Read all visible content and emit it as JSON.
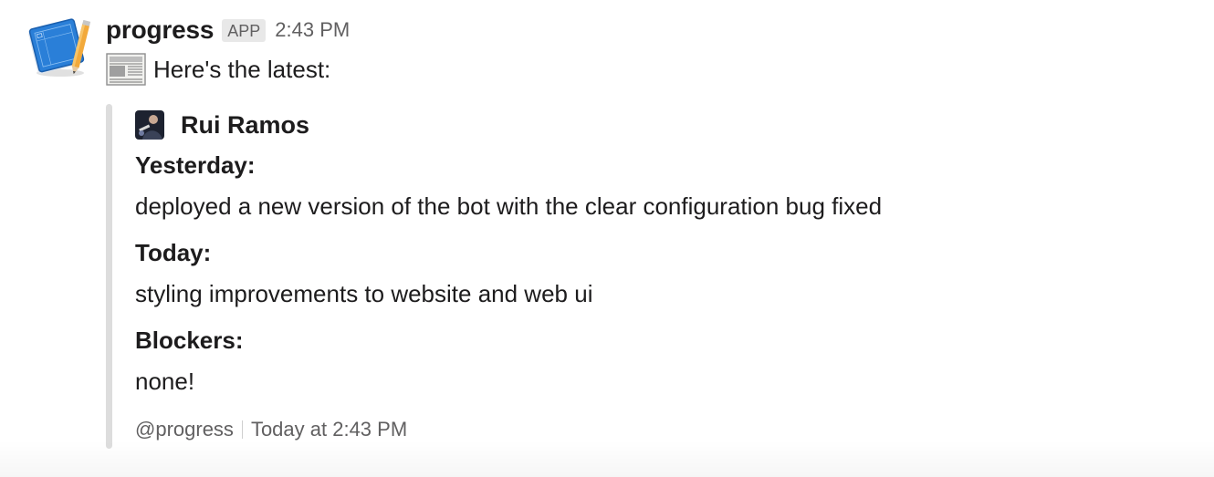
{
  "message": {
    "sender": "progress",
    "badge": "APP",
    "time": "2:43 PM",
    "intro_icon": "newspaper-icon",
    "intro_text": "Here's the latest:",
    "app_avatar_icon": "notebook-pencil-icon"
  },
  "attachment": {
    "accent_color": "#dddddd",
    "author": {
      "name": "Rui Ramos"
    },
    "fields": [
      {
        "title": "Yesterday:",
        "value": "deployed a new version of the bot with the clear configuration bug fixed"
      },
      {
        "title": "Today:",
        "value": "styling improvements to website and web ui"
      },
      {
        "title": "Blockers:",
        "value": "none!"
      }
    ],
    "footer": {
      "source": "@progress",
      "timestamp": "Today at 2:43 PM"
    }
  }
}
